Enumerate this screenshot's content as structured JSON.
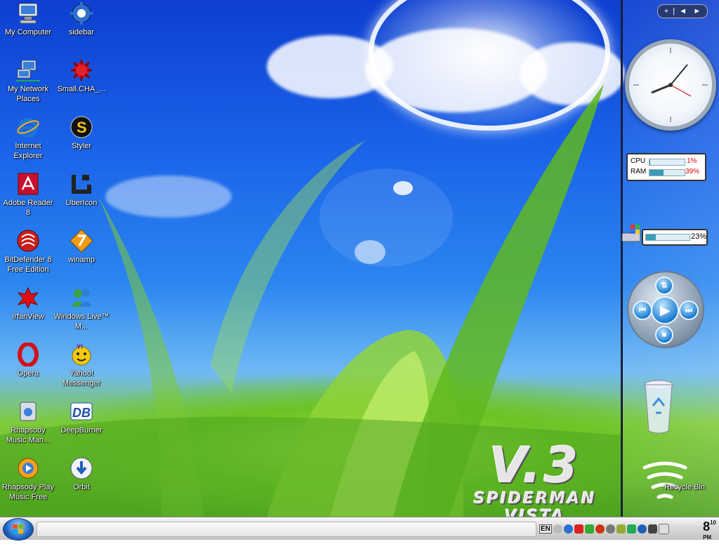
{
  "desktop_icons": [
    {
      "label": "My Computer",
      "icon": "computer-icon"
    },
    {
      "label": "sidebar",
      "icon": "gear-icon"
    },
    {
      "label": "My Network Places",
      "icon": "network-icon"
    },
    {
      "label": "Small.CHA_...",
      "icon": "virus-icon"
    },
    {
      "label": "Internet Explorer",
      "icon": "internet-explorer-icon"
    },
    {
      "label": "Styler",
      "icon": "styler-icon"
    },
    {
      "label": "Adobe Reader 8",
      "icon": "adobe-reader-icon"
    },
    {
      "label": "UberIcon",
      "icon": "ubericon-icon"
    },
    {
      "label": "BitDefender 8 Free Edition",
      "icon": "bitdefender-icon"
    },
    {
      "label": "winamp",
      "icon": "winamp-icon"
    },
    {
      "label": "IrfanView",
      "icon": "irfanview-icon"
    },
    {
      "label": "Windows Live™ M...",
      "icon": "messenger-icon"
    },
    {
      "label": "Opera",
      "icon": "opera-icon"
    },
    {
      "label": "Yahoo! Messenger",
      "icon": "yahoo-icon"
    },
    {
      "label": "Rhapsody Music Man...",
      "icon": "rhapsody-icon"
    },
    {
      "label": "DeepBurner",
      "icon": "deepburner-icon"
    },
    {
      "label": "Rhapsody Play Music Free",
      "icon": "rhapsody-play-icon"
    },
    {
      "label": "Orbit",
      "icon": "orbit-icon"
    }
  ],
  "recycle_bin": {
    "label": "Recycle Bin",
    "icon": "recycle-bin-icon"
  },
  "branding": {
    "version": "V.3",
    "title": "SPIDERMAN VISTA"
  },
  "sidebar": {
    "nav": {
      "add": "+",
      "prev": "◄",
      "next": "►"
    },
    "system_meter": {
      "cpu_label": "CPU",
      "cpu_value": "1%",
      "cpu_level": 0.01,
      "ram_label": "RAM",
      "ram_value": "39%",
      "ram_level": 0.39
    },
    "drive_meter": {
      "value": "23%",
      "level": 0.23
    }
  },
  "taskbar": {
    "language": "EN",
    "clock_hour": "8",
    "clock_minute": "10",
    "clock_ampm": "PM"
  },
  "colors": {
    "accent": "#1a62e8",
    "meter_fill": "#3e9bb5",
    "alert_red": "#e00000"
  }
}
